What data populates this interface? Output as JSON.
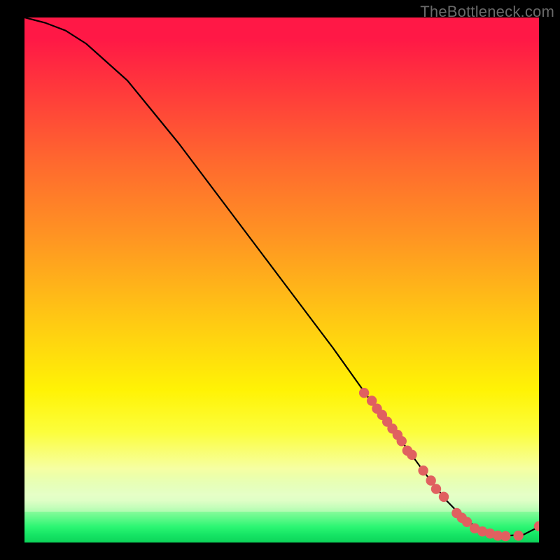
{
  "watermark": "TheBottleneck.com",
  "chart_data": {
    "type": "line",
    "title": "",
    "xlabel": "",
    "ylabel": "",
    "xlim": [
      0,
      100
    ],
    "ylim": [
      0,
      100
    ],
    "grid": false,
    "curve": {
      "name": "curve",
      "color": "#000000",
      "x": [
        0,
        4,
        8,
        12,
        20,
        30,
        40,
        50,
        60,
        68,
        72,
        78,
        82,
        86,
        90,
        94,
        97,
        100
      ],
      "y": [
        100,
        99,
        97.5,
        95,
        88,
        76,
        63,
        50,
        37,
        26,
        21,
        13,
        8,
        4,
        2,
        1.3,
        1.5,
        3
      ]
    },
    "series": [
      {
        "name": "highlight-points",
        "type": "scatter",
        "color": "#e06060",
        "x": [
          66,
          67.5,
          68.5,
          69.5,
          70.5,
          71.5,
          72.5,
          73.3,
          74.4,
          75.3,
          77.5,
          79,
          80,
          81.5,
          84,
          85,
          86,
          87.5,
          89,
          90.5,
          92,
          93.5,
          96,
          100
        ],
        "y": [
          28.5,
          27,
          25.5,
          24.3,
          23,
          21.7,
          20.5,
          19.3,
          17.5,
          16.7,
          13.7,
          11.8,
          10.2,
          8.7,
          5.6,
          4.7,
          3.9,
          2.7,
          2.1,
          1.7,
          1.3,
          1.2,
          1.3,
          3.1
        ]
      }
    ],
    "annotations": []
  }
}
